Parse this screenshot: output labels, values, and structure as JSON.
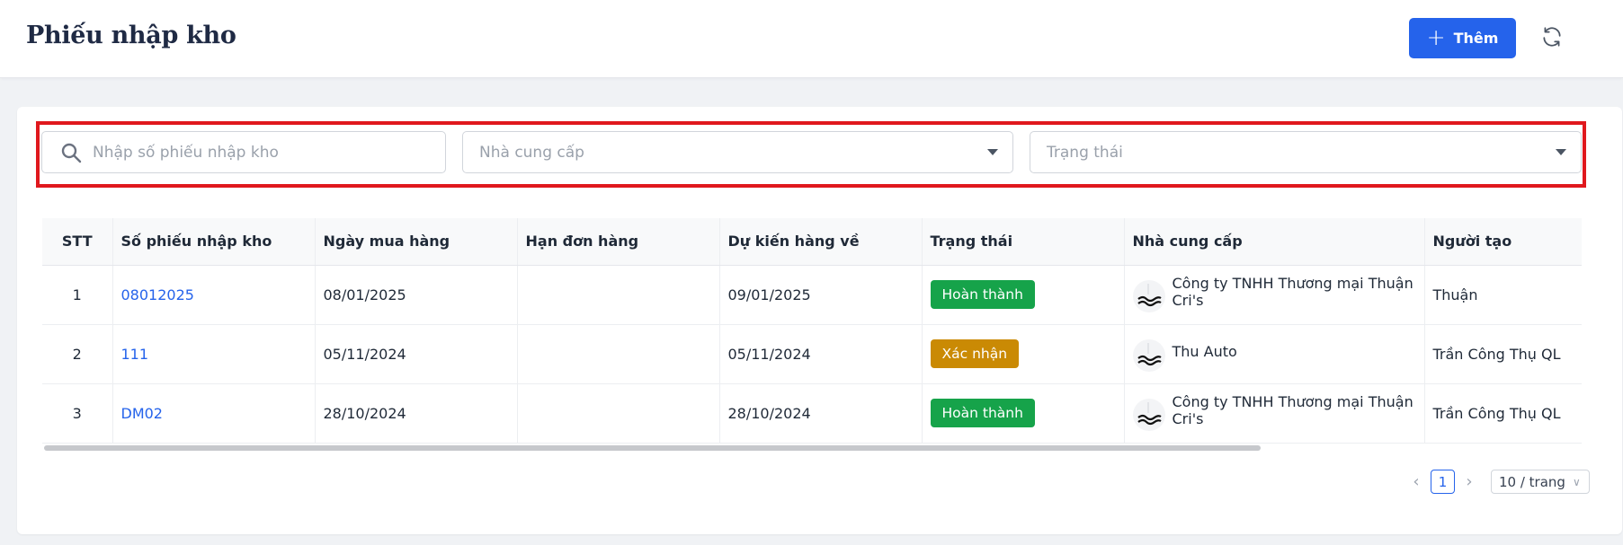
{
  "header": {
    "title": "Phiếu nhập kho",
    "add_label": "Thêm",
    "colors": {
      "primary": "#2563eb"
    }
  },
  "filters": {
    "search_placeholder": "Nhập số phiếu nhập kho",
    "supplier_placeholder": "Nhà cung cấp",
    "status_placeholder": "Trạng thái"
  },
  "table": {
    "columns": [
      "STT",
      "Số phiếu nhập kho",
      "Ngày mua hàng",
      "Hạn đơn hàng",
      "Dự kiến hàng về",
      "Trạng thái",
      "Nhà cung cấp",
      "Người tạo"
    ],
    "rows": [
      {
        "stt": "1",
        "code": "08012025",
        "purchase_date": "08/01/2025",
        "due_date": "",
        "expected_date": "09/01/2025",
        "status": "Hoàn thành",
        "status_color": "#16a34a",
        "supplier": "Công ty TNHH Thương mại Thuận Cri's",
        "creator": "Thuận"
      },
      {
        "stt": "2",
        "code": "111",
        "purchase_date": "05/11/2024",
        "due_date": "",
        "expected_date": "05/11/2024",
        "status": "Xác nhận",
        "status_color": "#ca8a04",
        "supplier": "Thu Auto",
        "creator": "Trần Công Thụ QL"
      },
      {
        "stt": "3",
        "code": "DM02",
        "purchase_date": "28/10/2024",
        "due_date": "",
        "expected_date": "28/10/2024",
        "status": "Hoàn thành",
        "status_color": "#16a34a",
        "supplier": "Công ty TNHH Thương mại Thuận Cri's",
        "creator": "Trần Công Thụ QL"
      }
    ]
  },
  "pagination": {
    "current_page": "1",
    "page_size": "10 / trang"
  }
}
